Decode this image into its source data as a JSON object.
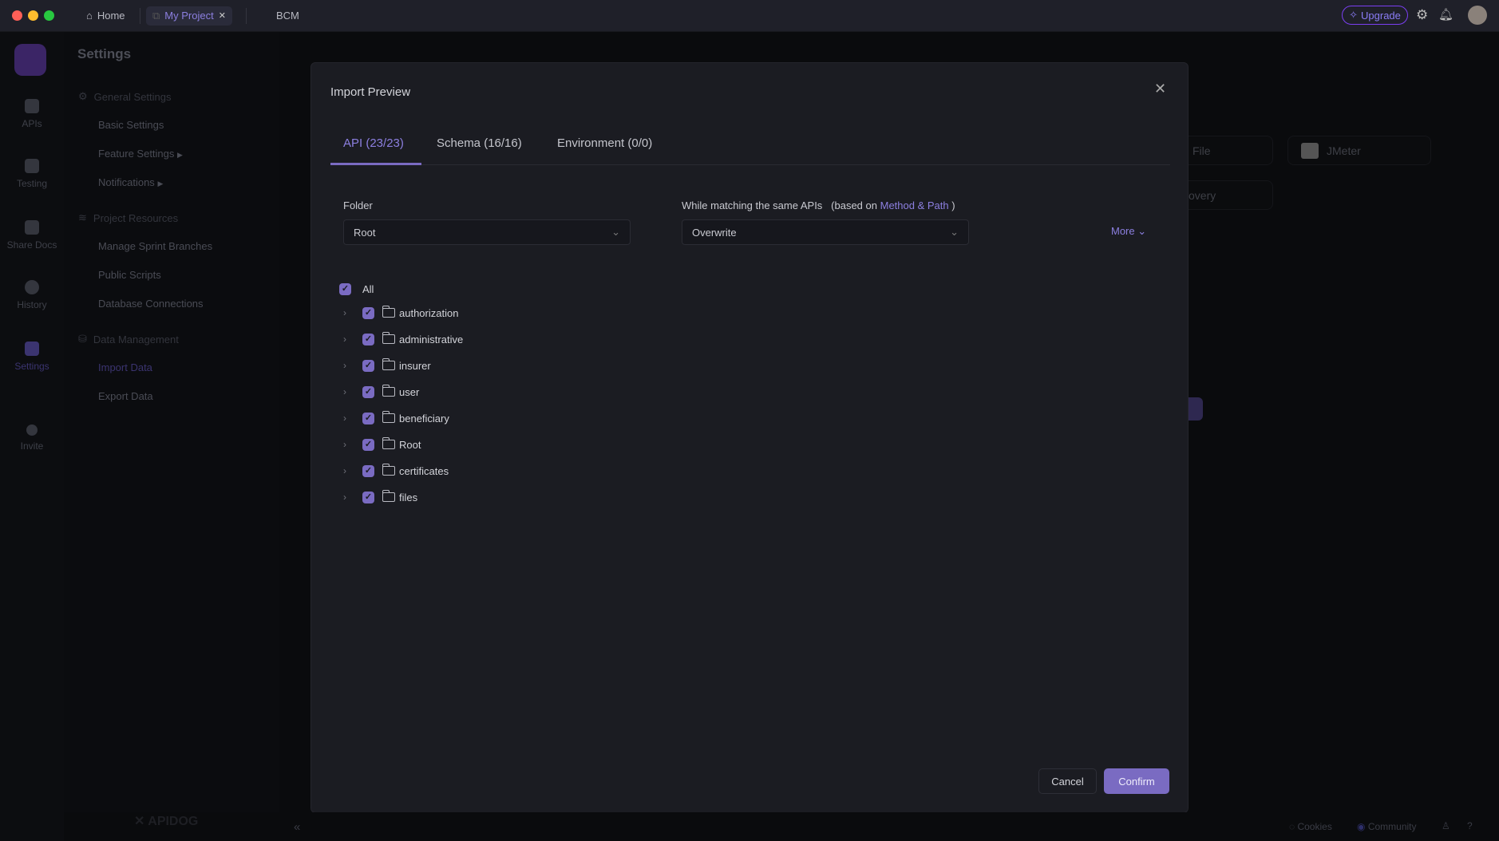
{
  "window": {
    "tabs": [
      {
        "label": "Home",
        "icon": "home-icon"
      },
      {
        "label": "My Project",
        "icon": "external-link-icon",
        "active": true
      },
      {
        "label": "BCM"
      }
    ],
    "upgrade_label": "Upgrade"
  },
  "rail": {
    "items": [
      {
        "label": "APIs"
      },
      {
        "label": "Testing"
      },
      {
        "label": "Share Docs"
      },
      {
        "label": "History"
      },
      {
        "label": "Settings",
        "active": true
      },
      {
        "label": "Invite"
      }
    ]
  },
  "settings": {
    "title": "Settings",
    "groups": [
      {
        "label": "General Settings",
        "items": [
          "Basic Settings",
          "Feature Settings",
          "Notifications"
        ]
      },
      {
        "label": "Project Resources",
        "items": [
          "Manage Sprint Branches",
          "Public Scripts",
          "Database Connections"
        ]
      },
      {
        "label": "Data Management",
        "items": [
          "Import Data",
          "Export Data"
        ]
      }
    ]
  },
  "background": {
    "cards": [
      "File",
      "JMeter",
      "le Discovery"
    ]
  },
  "modal": {
    "title": "Import Preview",
    "tabs": [
      "API (23/23)",
      "Schema (16/16)",
      "Environment (0/0)"
    ],
    "active_tab": 0,
    "folder_label": "Folder",
    "folder_value": "Root",
    "match_label": "While matching the same APIs",
    "match_based": "(based on",
    "match_link": "Method & Path",
    "match_close": ")",
    "match_value": "Overwrite",
    "more_label": "More",
    "all_label": "All",
    "folders": [
      "authorization",
      "administrative",
      "insurer",
      "user",
      "beneficiary",
      "Root",
      "certificates",
      "files"
    ],
    "cancel_label": "Cancel",
    "confirm_label": "Confirm"
  },
  "footer": {
    "brand": "APIDOG",
    "cookies": "Cookies",
    "community": "Community"
  },
  "colors": {
    "accent": "#7a6bc2",
    "bg": "#1b1c22"
  }
}
